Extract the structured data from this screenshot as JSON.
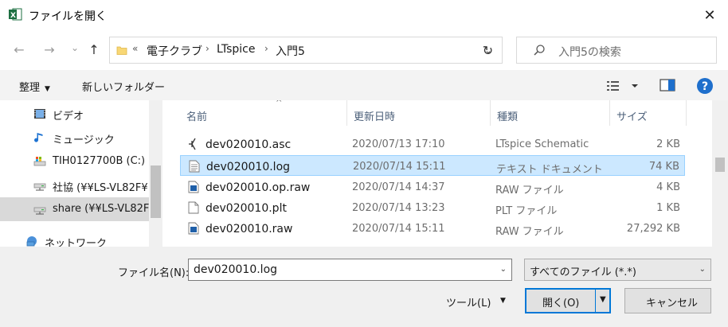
{
  "window": {
    "title": "ファイルを開く",
    "close_glyph": "✕"
  },
  "nav": {
    "back_glyph": "←",
    "forward_glyph": "→",
    "recent_glyph": "⌄",
    "up_glyph": "↑",
    "overflow_glyph": "«",
    "breadcrumbs": [
      "電子クラブ",
      "LTspice",
      "入門5"
    ],
    "separator": "›",
    "dropdown_glyph": "⌄",
    "refresh_glyph": "↻"
  },
  "search": {
    "placeholder": "入門5の検索"
  },
  "toolbar": {
    "organize_label": "整理",
    "organize_caret": "▼",
    "new_folder_label": "新しいフォルダー",
    "help_glyph": "?"
  },
  "sidebar": {
    "items": [
      {
        "label": "ビデオ",
        "icon": "video-folder-icon"
      },
      {
        "label": "ミュージック",
        "icon": "music-icon"
      },
      {
        "label": "TIH0127700B (C:)",
        "icon": "local-drive-icon"
      },
      {
        "label": "社協 (¥¥LS-VL82F¥",
        "icon": "network-drive-icon"
      },
      {
        "label": "share (¥¥LS-VL82F",
        "icon": "network-drive-icon"
      },
      {
        "label": "ネットワーク",
        "icon": "network-icon"
      }
    ]
  },
  "columns": {
    "name": "名前",
    "date": "更新日時",
    "type": "種類",
    "size": "サイズ",
    "sort_glyph": "^"
  },
  "files": [
    {
      "name": "dev020010.asc",
      "date": "2020/07/13 17:10",
      "type": "LTspice Schematic",
      "size": "2 KB",
      "icon": "schematic-file-icon"
    },
    {
      "name": "dev020010.log",
      "date": "2020/07/14 15:11",
      "type": "テキスト ドキュメント",
      "size": "74 KB",
      "icon": "text-file-icon"
    },
    {
      "name": "dev020010.op.raw",
      "date": "2020/07/14 14:37",
      "type": "RAW ファイル",
      "size": "4 KB",
      "icon": "raw-file-icon"
    },
    {
      "name": "dev020010.plt",
      "date": "2020/07/14 13:23",
      "type": "PLT ファイル",
      "size": "1 KB",
      "icon": "blank-file-icon"
    },
    {
      "name": "dev020010.raw",
      "date": "2020/07/14 15:11",
      "type": "RAW ファイル",
      "size": "27,292 KB",
      "icon": "raw-file-icon"
    }
  ],
  "footer": {
    "filename_label": "ファイル名(N):",
    "filename_value": "dev020010.log",
    "filetype_value": "すべてのファイル (*.*)",
    "tools_label": "ツール(L)",
    "open_label": "開く(O)",
    "cancel_label": "キャンセル",
    "dropdown_glyph": "⌄",
    "caret_glyph": "▼"
  },
  "colors": {
    "accent": "#0078d7",
    "selection_bg": "#cce8ff",
    "selection_border": "#99d1ff",
    "excel_green": "#1d6f42"
  }
}
